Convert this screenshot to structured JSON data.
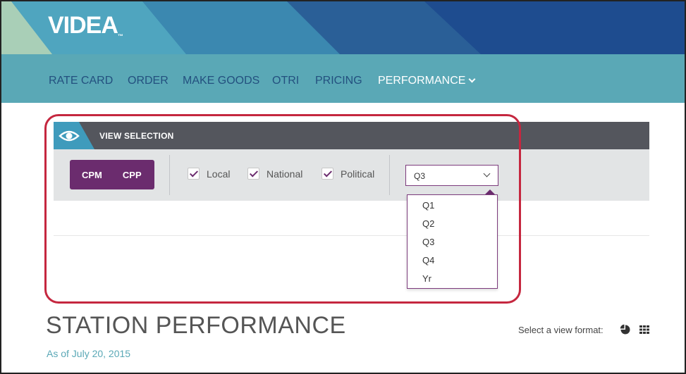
{
  "brand": {
    "logo_text": "VIDEA",
    "logo_mark": "™"
  },
  "nav": {
    "items": [
      {
        "label": "RATE CARD"
      },
      {
        "label": "ORDER"
      },
      {
        "label": "MAKE GOODS"
      },
      {
        "label": "OTRI"
      },
      {
        "label": "PRICING"
      },
      {
        "label": "PERFORMANCE"
      }
    ]
  },
  "view_selection": {
    "title": "VIEW SELECTION",
    "icon": "eye-icon",
    "metric_toggle": {
      "options": [
        "CPM",
        "CPP"
      ]
    },
    "filters": [
      {
        "label": "Local",
        "checked": true
      },
      {
        "label": "National",
        "checked": true
      },
      {
        "label": "Political",
        "checked": true
      }
    ],
    "period_select": {
      "value": "Q3",
      "options": [
        "Q1",
        "Q2",
        "Q3",
        "Q4",
        "Yr"
      ]
    }
  },
  "page": {
    "title": "STATION PERFORMANCE",
    "subtitle": "As of July 20, 2015",
    "view_format_label": "Select a view format:",
    "view_format_icons": [
      "pie-chart-icon",
      "grid-icon"
    ]
  },
  "colors": {
    "nav_bg": "#5aa8b6",
    "nav_text": "#23507f",
    "accent_purple": "#6b2c6e",
    "highlight_red": "#c5273f",
    "bar_dark": "#54565d"
  }
}
